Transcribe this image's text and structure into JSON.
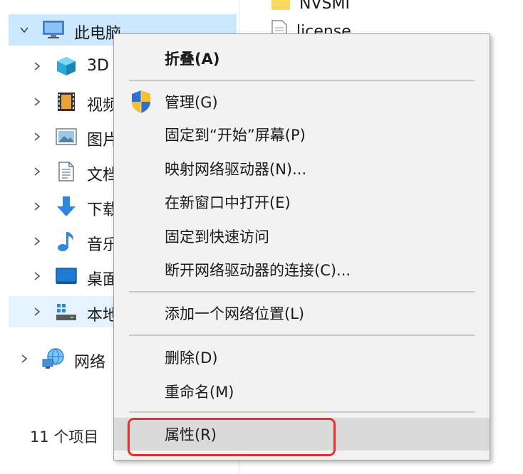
{
  "nav_pane": {
    "items": [
      {
        "label": "此电脑",
        "icon": "computer-icon",
        "expanded": true
      },
      {
        "label": "3D",
        "icon": "3d-objects-icon"
      },
      {
        "label": "视频",
        "icon": "videos-icon"
      },
      {
        "label": "图片",
        "icon": "pictures-icon"
      },
      {
        "label": "文档",
        "icon": "documents-icon"
      },
      {
        "label": "下载",
        "icon": "downloads-icon"
      },
      {
        "label": "音乐",
        "icon": "music-icon"
      },
      {
        "label": "桌面",
        "icon": "desktop-icon"
      },
      {
        "label": "本地",
        "icon": "local-disk-icon"
      },
      {
        "label": "网络",
        "icon": "network-icon"
      }
    ],
    "status": "11 个项目"
  },
  "file_pane": {
    "items": [
      {
        "label": "NVSMI",
        "icon": "folder-icon"
      },
      {
        "label": "license",
        "icon": "text-file-icon"
      }
    ]
  },
  "context_menu": {
    "collapse": "折叠(A)",
    "manage": "管理(G)",
    "pin_start": "固定到“开始”屏幕(P)",
    "map_drive": "映射网络驱动器(N)...",
    "open_new_window": "在新窗口中打开(E)",
    "pin_quick_access": "固定到快速访问",
    "disconnect_drive": "断开网络驱动器的连接(C)...",
    "add_network_location": "添加一个网络位置(L)",
    "delete": "删除(D)",
    "rename": "重命名(M)",
    "properties": "属性(R)"
  },
  "colors": {
    "selection": "#cce8ff",
    "menu_background": "#f2f2f2",
    "highlight_outline": "#e5302a"
  }
}
